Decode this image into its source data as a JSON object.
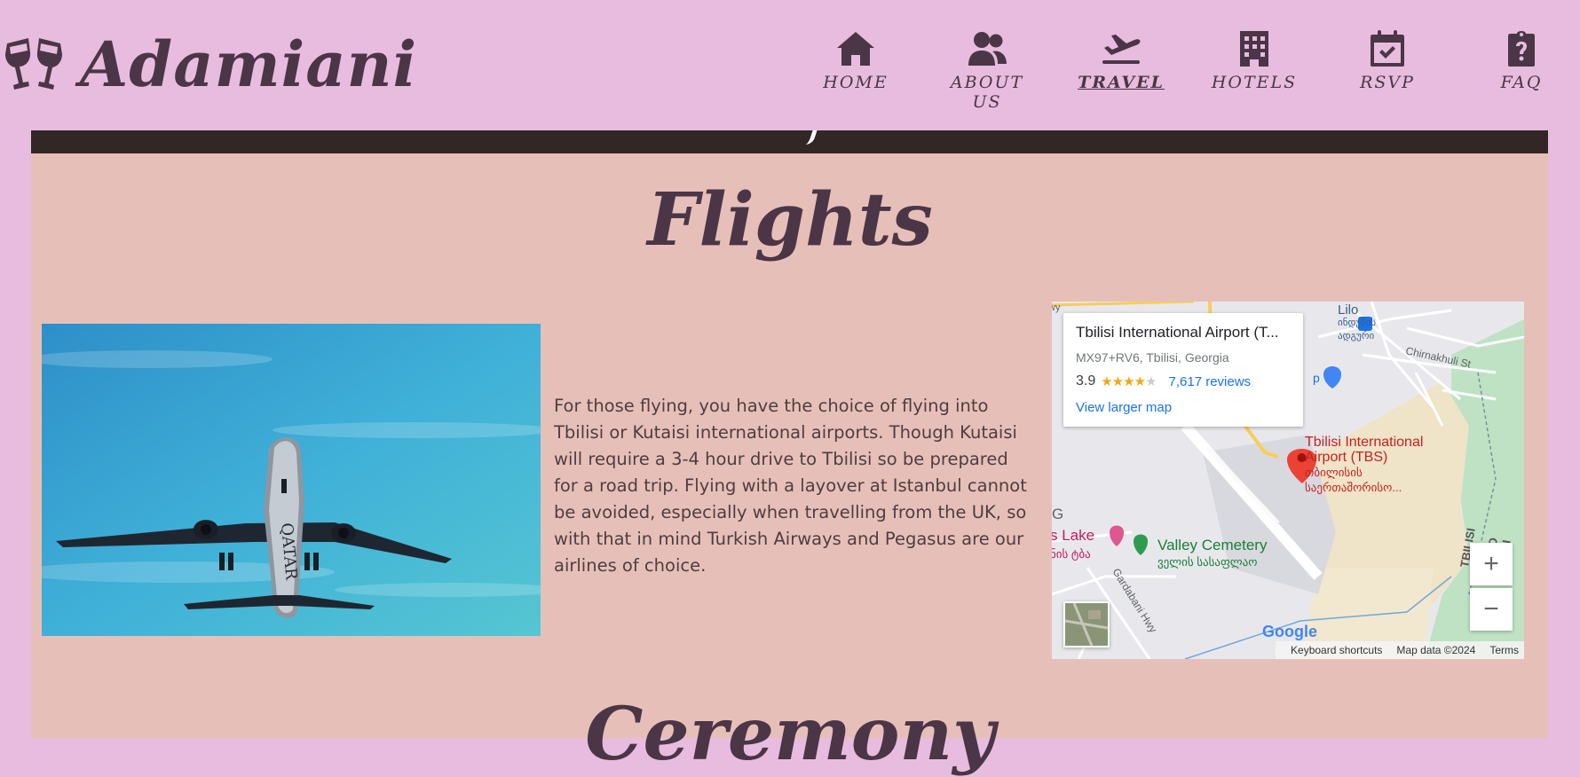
{
  "brand": {
    "name": "Adamiani",
    "icon": "wine-glasses-icon"
  },
  "nav": {
    "items": [
      {
        "label": "HOME",
        "icon": "home-icon"
      },
      {
        "label": "ABOUT US",
        "icon": "users-icon"
      },
      {
        "label": "TRAVEL",
        "icon": "plane-departure-icon",
        "active": true
      },
      {
        "label": "HOTELS",
        "icon": "hotel-building-icon"
      },
      {
        "label": "RSVP",
        "icon": "calendar-check-icon"
      },
      {
        "label": "FAQ",
        "icon": "clipboard-question-icon"
      }
    ]
  },
  "colors": {
    "page_bg": "#e8bcdf",
    "panel_bg": "#e7bfb9",
    "accent": "#4a3646",
    "strip": "#312826"
  },
  "flights": {
    "title": "Flights",
    "body": "For those flying, you have the choice of flying into Tbilisi or Kutaisi international airports. Though Kutaisi will require a 3-4 hour drive to Tbilisi so be prepared for a road trip. Flying with a layover at Istanbul cannot be avoided, especially when travelling from the UK, so with that in mind Turkish Airways and Pegasus are our airlines of choice.",
    "photo_airline_text": "QATAR"
  },
  "map": {
    "card_title": "Tbilisi International Airport (T...",
    "card_address": "MX97+RV6, Tbilisi, Georgia",
    "rating": "3.9",
    "stars_filled": 4,
    "reviews": "7,617 reviews",
    "view_larger": "View larger map",
    "pin_label_line1": "Tbilisi International",
    "pin_label_line2": "Airport (TBS)",
    "pin_sub1": "თბილისის",
    "pin_sub2": "საერთაშორისო...",
    "valley_label": "Valley Cemetery",
    "valley_sub": "ველის სასაფლაო",
    "lake_label": "s Lake",
    "lake_sub": "ნის ტბა",
    "lilo_label": "Lilo",
    "lilo_sub1": "ინდუზის",
    "lilo_sub2": "ადგური",
    "street_label": "Chirnakhuli St",
    "highway_label": "Gardabani Hwy",
    "g_label": "G",
    "tbilisi_road": "TBILISI",
    "kartli_road": "KVEMO KARTLI",
    "wy_label": "wy",
    "p_label": "p",
    "zoom_in": "+",
    "zoom_out": "−",
    "google": "Google",
    "footer_shortcuts": "Keyboard shortcuts",
    "footer_data": "Map data ©2024",
    "footer_terms": "Terms"
  },
  "ceremony": {
    "title": "Ceremony"
  }
}
